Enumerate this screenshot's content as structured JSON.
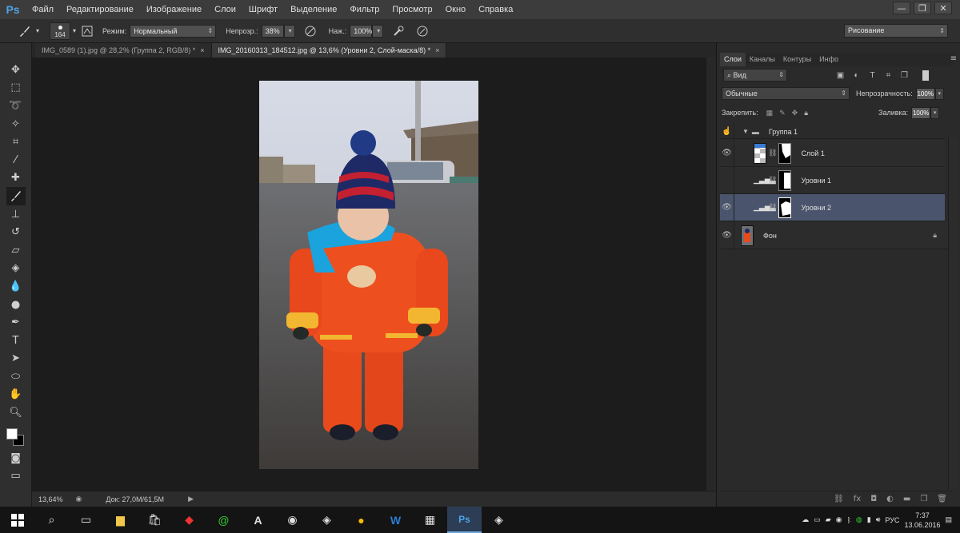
{
  "app": {
    "logo": "Ps"
  },
  "menu": [
    "Файл",
    "Редактирование",
    "Изображение",
    "Слои",
    "Шрифт",
    "Выделение",
    "Фильтр",
    "Просмотр",
    "Окно",
    "Справка"
  ],
  "window_controls": [
    "—",
    "❐",
    "✕"
  ],
  "options": {
    "brush_size": "164",
    "mode_label": "Режим:",
    "mode_value": "Нормальный",
    "opacity_label": "Непрозр.:",
    "opacity_value": "38%",
    "flow_label": "Наж.:",
    "flow_value": "100%",
    "workspace": "Рисование"
  },
  "tabs": [
    {
      "label": "IMG_0589 (1).jpg @ 28,2% (Группа 2, RGB/8) *",
      "close": "×",
      "active": false
    },
    {
      "label": "IMG_20160313_184512.jpg @ 13,6% (Уровни 2, Слой-маска/8) *",
      "close": "×",
      "active": true
    }
  ],
  "tools": [
    "move-icon",
    "marquee-icon",
    "lasso-icon",
    "magic-wand-icon",
    "crop-icon",
    "eyedropper-icon",
    "healing-icon",
    "brush-icon",
    "stamp-icon",
    "history-brush-icon",
    "eraser-icon",
    "bucket-icon",
    "blur-icon",
    "dodge-icon",
    "pen-icon",
    "type-icon",
    "path-select-icon",
    "ellipse-icon",
    "hand-icon",
    "zoom-icon"
  ],
  "status": {
    "zoom": "13,64%",
    "doc": "Док: 27,0M/61,5M"
  },
  "panel": {
    "tabs": [
      "Слои",
      "Каналы",
      "Контуры",
      "Инфо"
    ],
    "filter_kind": "Вид",
    "blend_mode": "Обычные",
    "opacity_label": "Непрозрачность:",
    "opacity_value": "100%",
    "lock_label": "Закрепить:",
    "fill_label": "Заливка:",
    "fill_value": "100%",
    "group_name": "Группа 1",
    "layers": [
      {
        "name": "Слой 1",
        "visible": true,
        "type": "pixel"
      },
      {
        "name": "Уровни 1",
        "visible": false,
        "type": "levels"
      },
      {
        "name": "Уровни 2",
        "visible": true,
        "type": "levels",
        "selected": true
      },
      {
        "name": "Фон",
        "visible": true,
        "type": "background"
      }
    ]
  },
  "taskbar": {
    "lang": "РУС",
    "time": "7:37",
    "date": "13.06.2016"
  }
}
